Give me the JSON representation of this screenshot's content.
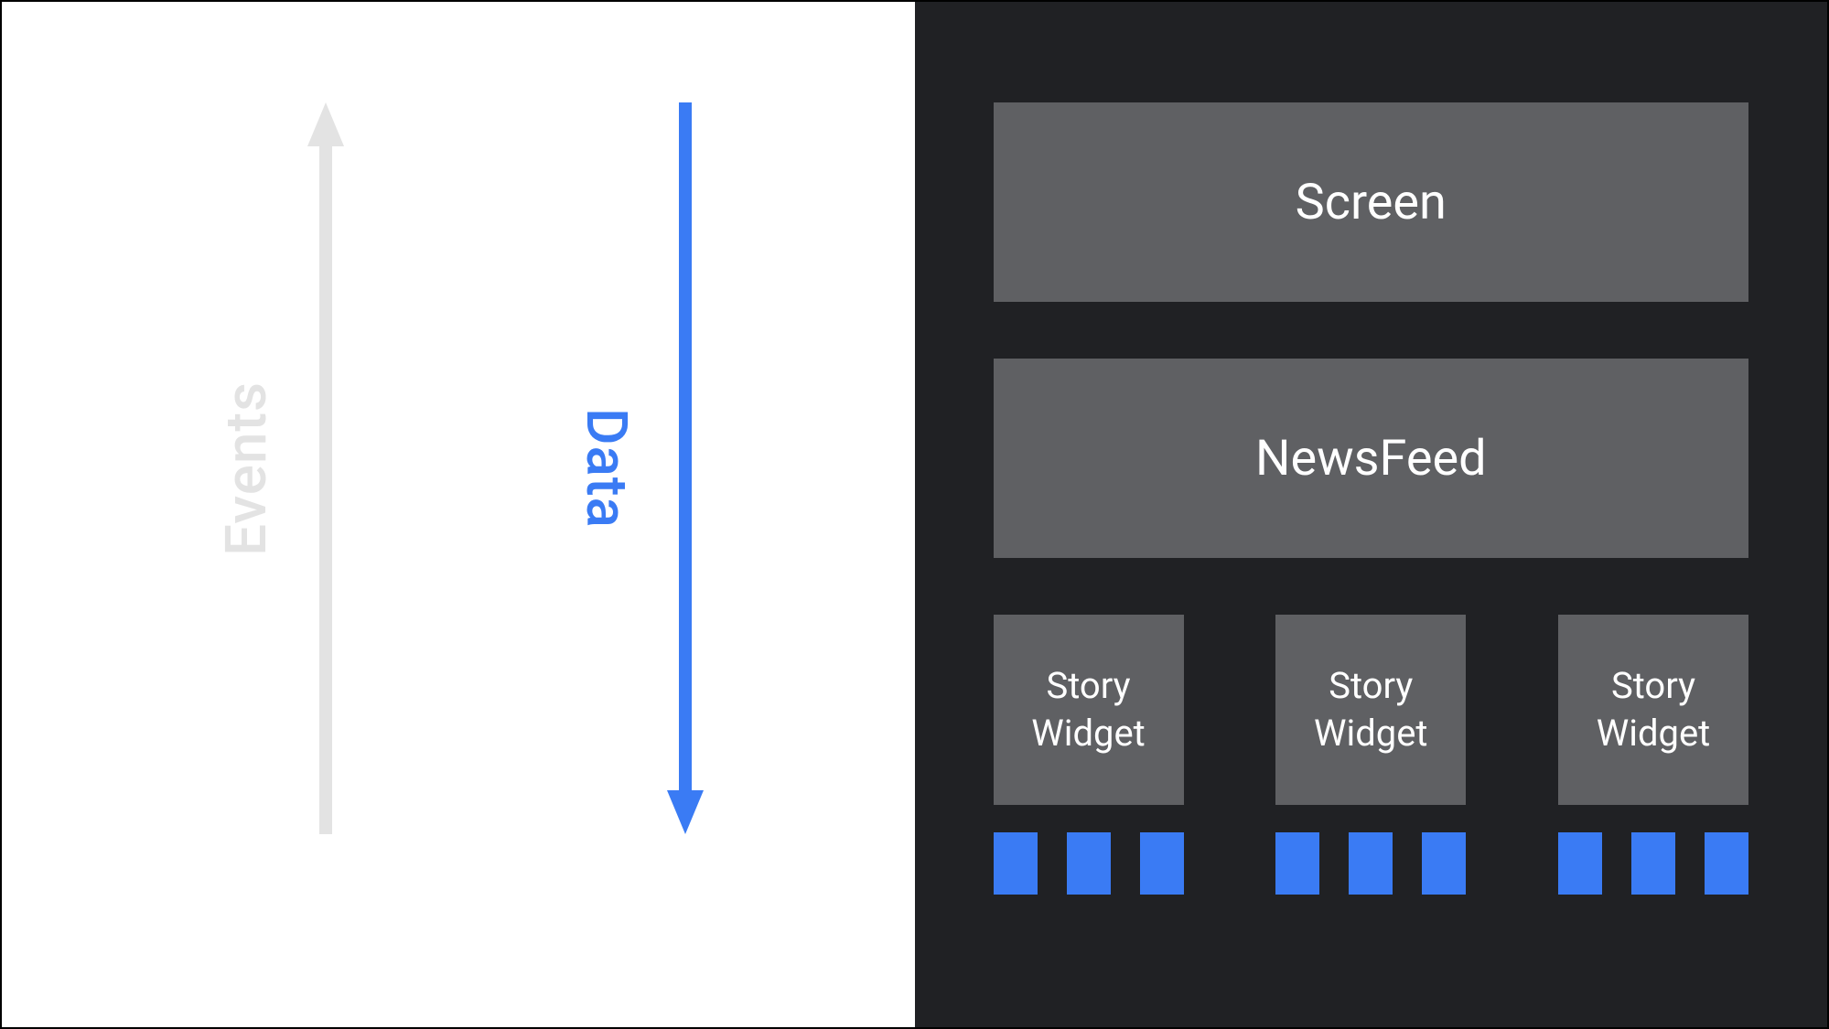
{
  "left": {
    "events_label": "Events",
    "data_label": "Data",
    "colors": {
      "events": "#e3e3e3",
      "data": "#3a7bf4"
    }
  },
  "right": {
    "screen_label": "Screen",
    "newsfeed_label": "NewsFeed",
    "story_widgets": [
      "Story\nWidget",
      "Story\nWidget",
      "Story\nWidget"
    ],
    "blue_blocks_per_group": 3,
    "blue_group_count": 3,
    "colors": {
      "panel_bg": "#202124",
      "box_bg": "#5f6063",
      "blue": "#3a7bf4"
    }
  }
}
